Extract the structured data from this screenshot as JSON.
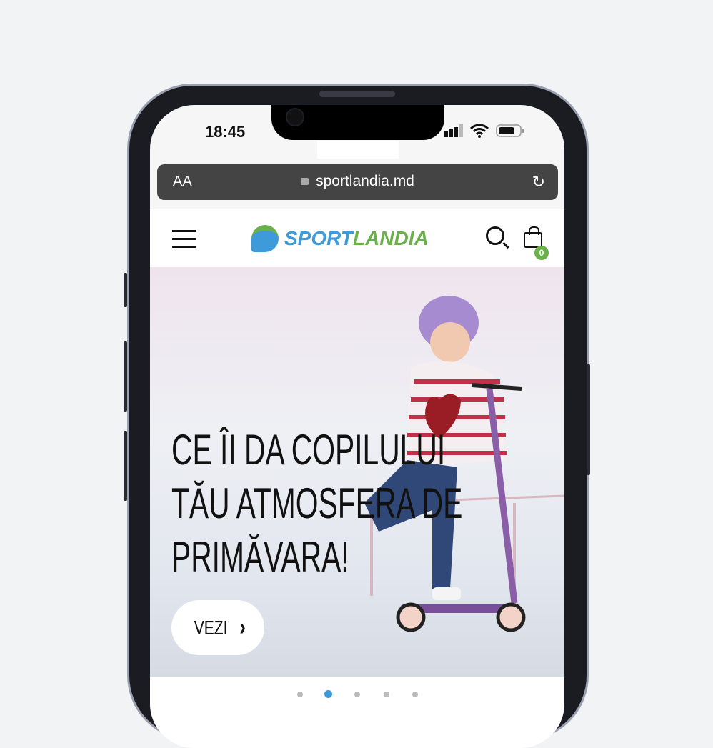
{
  "status_bar": {
    "time": "18:45"
  },
  "browser": {
    "text_size_label": "AA",
    "url": "sportlandia.md",
    "reload_icon": "reload-icon",
    "lock_icon": "lock-icon"
  },
  "header": {
    "logo_part1": "SPORT",
    "logo_part2": "LANDIA",
    "cart_count": "0"
  },
  "hero": {
    "line1": "CE ÎI DA COPILULUI",
    "line2": "TĂU ATMOSFERA DE",
    "line3": "PRIMĂVARA!",
    "button_label": "VEZI",
    "button_icon": "›"
  },
  "carousel": {
    "slide_count": 5,
    "active_index": 1
  },
  "colors": {
    "brand_blue": "#3e9ad8",
    "brand_green": "#6ab04c"
  }
}
